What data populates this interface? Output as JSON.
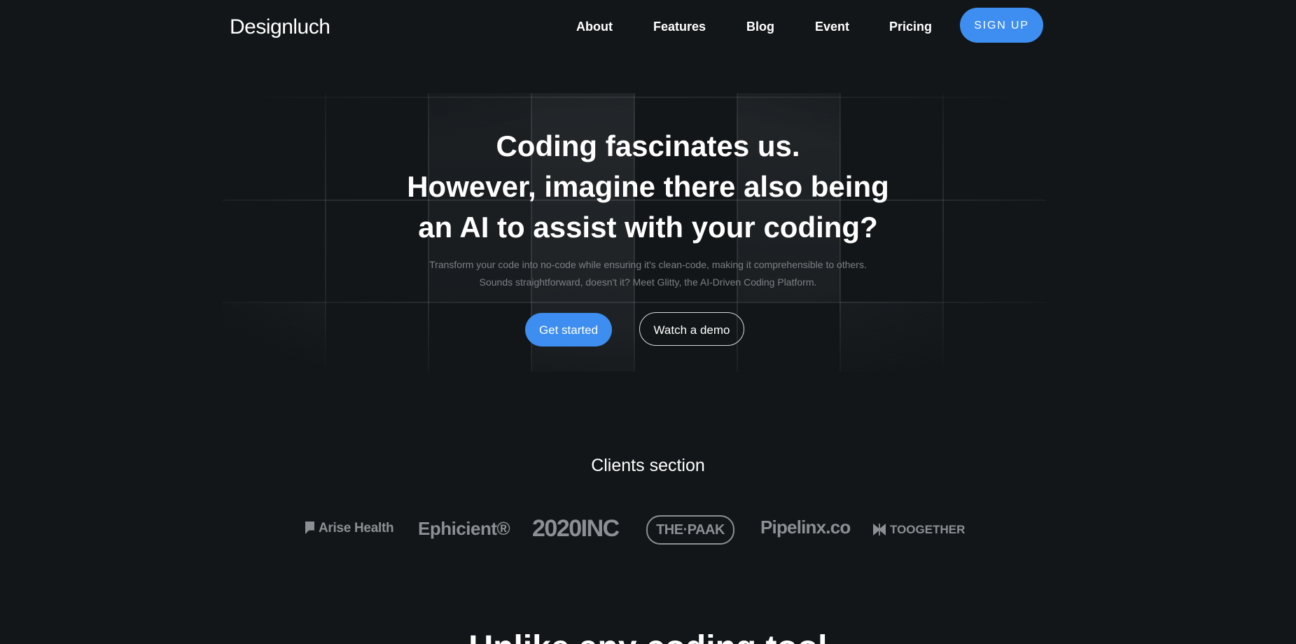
{
  "brand": {
    "name": "Designluch"
  },
  "nav": {
    "items": [
      {
        "label": "About"
      },
      {
        "label": "Features"
      },
      {
        "label": "Blog"
      },
      {
        "label": "Event"
      },
      {
        "label": "Pricing"
      }
    ],
    "signup_label": "SIGN UP"
  },
  "hero": {
    "headline": [
      "Coding fascinates us.",
      "However, imagine there also being",
      "an AI to assist with your coding?"
    ],
    "subtitle": [
      "Transform your code into no-code while ensuring it's clean-code, making it comprehensible to others.",
      "Sounds straightforward, doesn't it? Meet Glitty, the AI-Driven Coding Platform."
    ],
    "primary_cta": "Get started",
    "secondary_cta": "Watch a demo"
  },
  "clients": {
    "title": "Clients section",
    "logos": [
      {
        "name": "Arise Health",
        "icon": "flag-icon"
      },
      {
        "name": "Ephicient®"
      },
      {
        "name": "2020INC"
      },
      {
        "name": "THE·PAAK"
      },
      {
        "name": "Pipelinx.co"
      },
      {
        "name": "TOOGETHER",
        "icon": "bowtie-icon"
      }
    ]
  },
  "next_section": {
    "heading": "Unlike any coding tool"
  },
  "colors": {
    "background": "#121618",
    "accent": "#3d8ef0",
    "text": "#ffffff",
    "muted_text": "#7c8185",
    "logo_gray": "#8c9094"
  }
}
